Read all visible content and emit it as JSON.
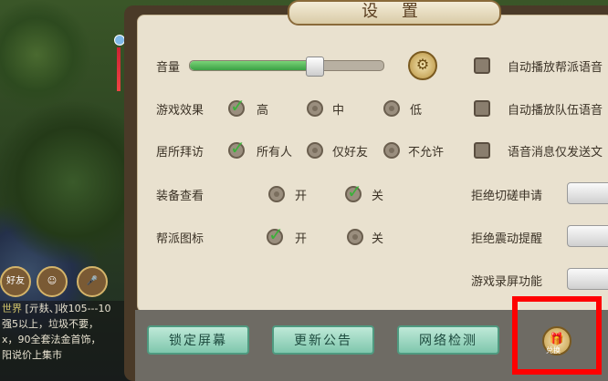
{
  "window_title": "设 置",
  "volume": {
    "label": "音量",
    "level": 0.64
  },
  "rows": [
    {
      "label": "游戏效果",
      "options": [
        "高",
        "中",
        "低"
      ],
      "selected": 0
    },
    {
      "label": "居所拜访",
      "options": [
        "所有人",
        "仅好友",
        "不允许"
      ],
      "selected": 0
    },
    {
      "label": "装备查看",
      "options": [
        "开",
        "关"
      ],
      "selected": 1
    },
    {
      "label": "帮派图标",
      "options": [
        "开",
        "关"
      ],
      "selected": 0
    }
  ],
  "checkboxes": [
    {
      "label": "自动播放帮派语音"
    },
    {
      "label": "自动播放队伍语音"
    },
    {
      "label": "语音消息仅发送文"
    }
  ],
  "toggles": [
    {
      "label": "拒绝切磋申请"
    },
    {
      "label": "拒绝震动提醒"
    },
    {
      "label": "游戏录屏功能"
    }
  ],
  "buttons": {
    "lock": "锁定屏幕",
    "update": "更新公告",
    "network": "网络检测"
  },
  "gift_label": "兑换",
  "chat": {
    "channel": "世界",
    "lines": [
      "[亓麸、]收105---10",
      "强5以上，垃圾不要，",
      "x，90全套法金首饰，",
      "阳说价上集市"
    ]
  },
  "chat_icons": [
    "好友"
  ]
}
